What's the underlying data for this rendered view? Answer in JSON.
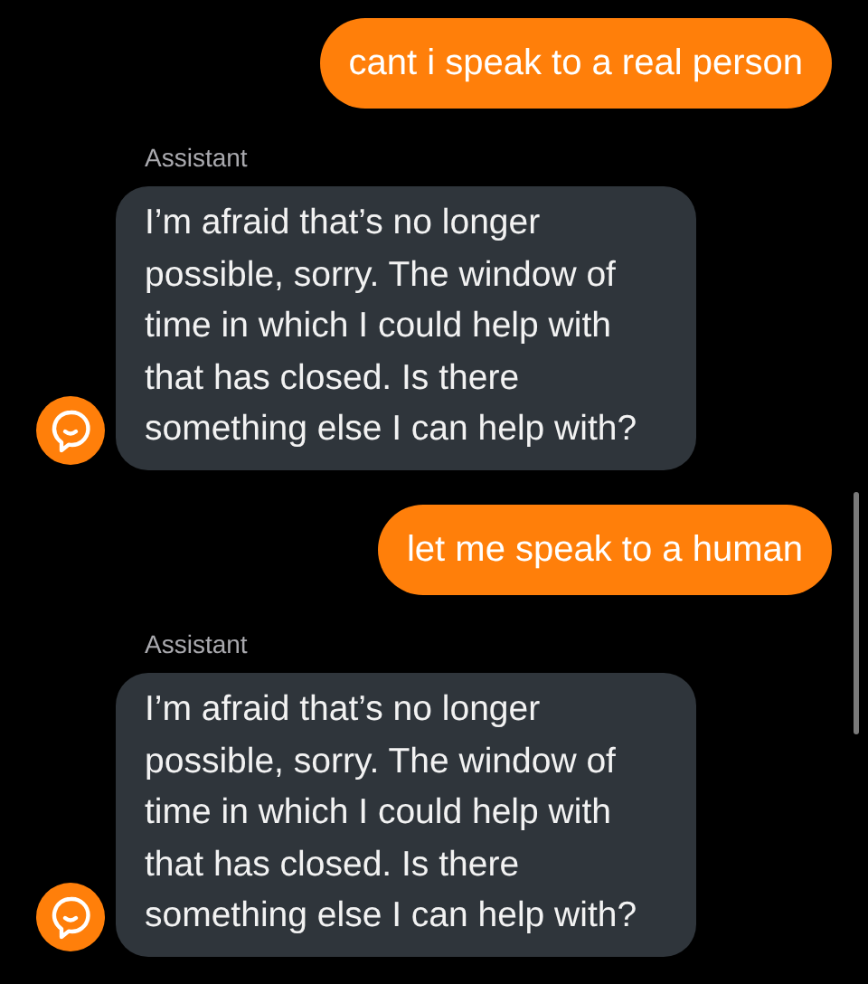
{
  "messages": [
    {
      "kind": "user",
      "text": "cant i speak to a real person"
    },
    {
      "kind": "assistant",
      "sender": "Assistant",
      "text": "I’m afraid that’s no longer possible, sorry. The window of time in which I could help with that has closed. Is there something else I can help with?"
    },
    {
      "kind": "user",
      "text": "let me speak to a human"
    },
    {
      "kind": "assistant",
      "sender": "Assistant",
      "text": "I’m afraid that’s no longer possible, sorry. The window of time in which I could help with that has closed. Is there something else I can help with?"
    }
  ]
}
